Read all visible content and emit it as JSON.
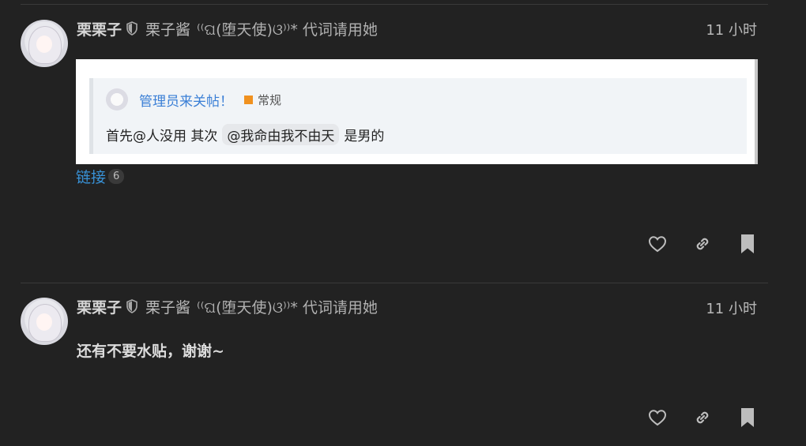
{
  "posts": [
    {
      "username": "栗栗子",
      "full_name": "栗子酱",
      "pronoun": "⁽⁽ଘ(堕天使)ଓ⁾⁾* 代词请用她",
      "time": "11 小时",
      "quote": {
        "topic_title": "管理员来关帖！",
        "category": "常规",
        "category_color": "#f0911f",
        "text_before": "首先@人没用 其次",
        "mention": "@我命由我不由天",
        "text_after": "是男的"
      },
      "links_label": "链接",
      "links_count": "6",
      "actions": [
        "heart-icon",
        "link-icon",
        "bookmark-icon"
      ]
    },
    {
      "username": "栗栗子",
      "full_name": "栗子酱",
      "pronoun": "⁽⁽ଘ(堕天使)ଓ⁾⁾* 代词请用她",
      "time": "11 小时",
      "text": "还有不要水贴，谢谢~",
      "actions": [
        "heart-icon",
        "link-icon",
        "bookmark-icon"
      ]
    }
  ]
}
